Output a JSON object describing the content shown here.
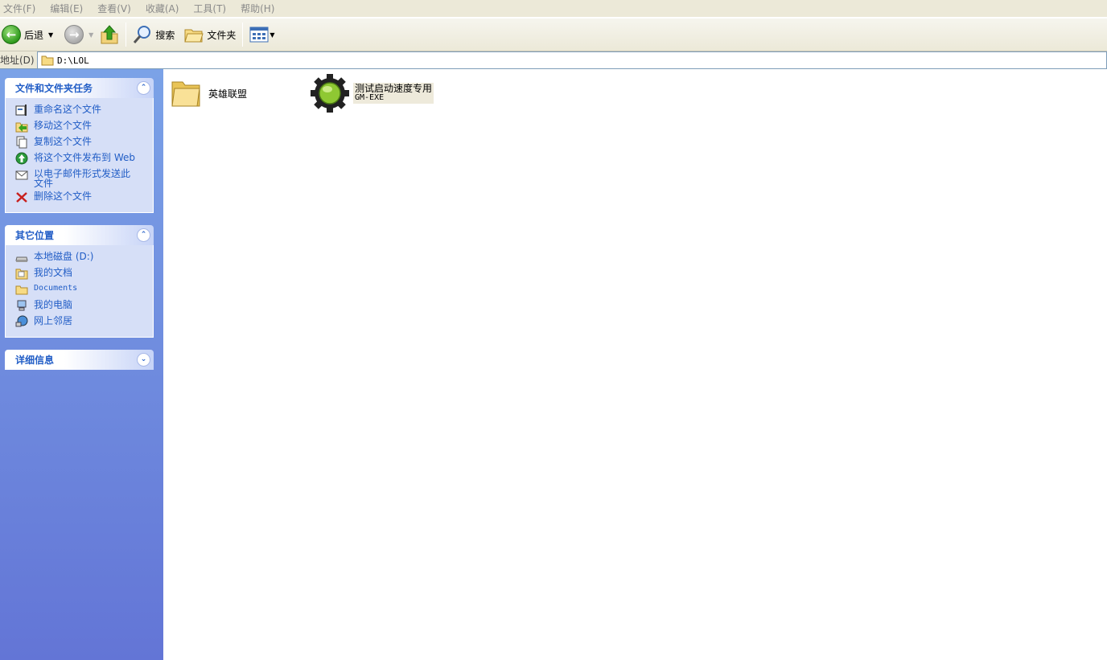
{
  "menu": [
    "文件(F)",
    "编辑(E)",
    "查看(V)",
    "收藏(A)",
    "工具(T)",
    "帮助(H)"
  ],
  "toolbar": {
    "back_label": "后退",
    "search_label": "搜索",
    "folders_label": "文件夹"
  },
  "address": {
    "label": "地址(D)",
    "path": "D:\\LOL"
  },
  "tasks_panel": {
    "title": "文件和文件夹任务",
    "items": [
      "重命名这个文件",
      "移动这个文件",
      "复制这个文件",
      "将这个文件发布到 Web",
      "以电子邮件形式发送此文件",
      "删除这个文件"
    ]
  },
  "places_panel": {
    "title": "其它位置",
    "items": [
      "本地磁盘 (D:)",
      "我的文档",
      "Documents",
      "我的电脑",
      "网上邻居"
    ]
  },
  "details_panel": {
    "title": "详细信息"
  },
  "files": [
    {
      "name": "英雄联盟",
      "icon": "folder-icon"
    },
    {
      "name": "测试启动速度专用",
      "subtitle": "GM-EXE",
      "icon": "gear-icon"
    }
  ]
}
